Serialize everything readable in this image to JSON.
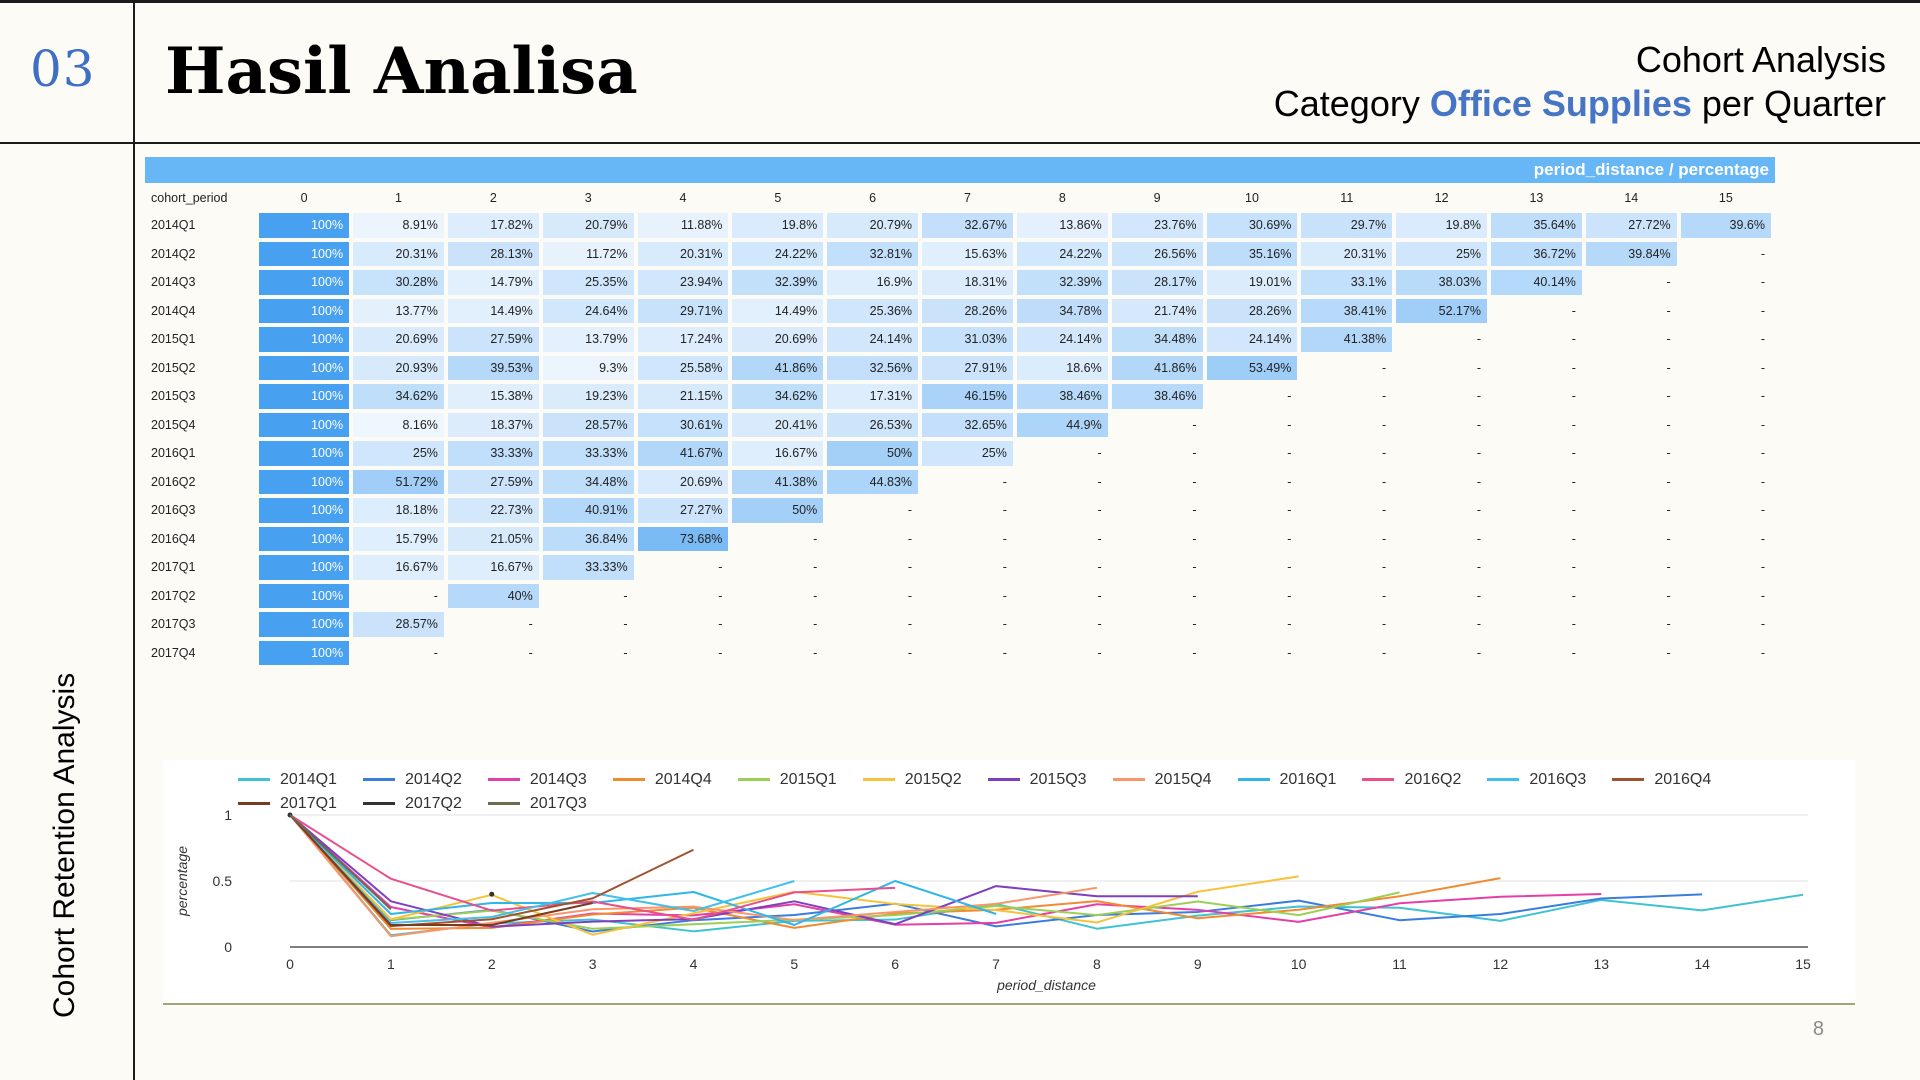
{
  "header": {
    "section_number": "03",
    "title": "Hasil Analisa",
    "subtitle_line1": "Cohort Analysis",
    "subtitle_prefix": "Category ",
    "subtitle_highlight": "Office Supplies",
    "subtitle_suffix": " per Quarter"
  },
  "side_label": "Cohort Retention Analysis",
  "page_number": "8",
  "colors": {
    "accent_blue": "#4675c6",
    "header_bar": "#67b7f7",
    "heat_full": "#47a1f0"
  },
  "table": {
    "header_bar_label": "period_distance / percentage",
    "row_header_label": "cohort_period",
    "columns": [
      "0",
      "1",
      "2",
      "3",
      "4",
      "5",
      "6",
      "7",
      "8",
      "9",
      "10",
      "11",
      "12",
      "13",
      "14",
      "15"
    ],
    "rows": [
      {
        "cohort": "2014Q1",
        "values": [
          "100%",
          "8.91%",
          "17.82%",
          "20.79%",
          "11.88%",
          "19.8%",
          "20.79%",
          "32.67%",
          "13.86%",
          "23.76%",
          "30.69%",
          "29.7%",
          "19.8%",
          "35.64%",
          "27.72%",
          "39.6%"
        ]
      },
      {
        "cohort": "2014Q2",
        "values": [
          "100%",
          "20.31%",
          "28.13%",
          "11.72%",
          "20.31%",
          "24.22%",
          "32.81%",
          "15.63%",
          "24.22%",
          "26.56%",
          "35.16%",
          "20.31%",
          "25%",
          "36.72%",
          "39.84%",
          "-"
        ]
      },
      {
        "cohort": "2014Q3",
        "values": [
          "100%",
          "30.28%",
          "14.79%",
          "25.35%",
          "23.94%",
          "32.39%",
          "16.9%",
          "18.31%",
          "32.39%",
          "28.17%",
          "19.01%",
          "33.1%",
          "38.03%",
          "40.14%",
          "-",
          "-"
        ]
      },
      {
        "cohort": "2014Q4",
        "values": [
          "100%",
          "13.77%",
          "14.49%",
          "24.64%",
          "29.71%",
          "14.49%",
          "25.36%",
          "28.26%",
          "34.78%",
          "21.74%",
          "28.26%",
          "38.41%",
          "52.17%",
          "-",
          "-",
          "-"
        ]
      },
      {
        "cohort": "2015Q1",
        "values": [
          "100%",
          "20.69%",
          "27.59%",
          "13.79%",
          "17.24%",
          "20.69%",
          "24.14%",
          "31.03%",
          "24.14%",
          "34.48%",
          "24.14%",
          "41.38%",
          "-",
          "-",
          "-",
          "-"
        ]
      },
      {
        "cohort": "2015Q2",
        "values": [
          "100%",
          "20.93%",
          "39.53%",
          "9.3%",
          "25.58%",
          "41.86%",
          "32.56%",
          "27.91%",
          "18.6%",
          "41.86%",
          "53.49%",
          "-",
          "-",
          "-",
          "-",
          "-"
        ]
      },
      {
        "cohort": "2015Q3",
        "values": [
          "100%",
          "34.62%",
          "15.38%",
          "19.23%",
          "21.15%",
          "34.62%",
          "17.31%",
          "46.15%",
          "38.46%",
          "38.46%",
          "-",
          "-",
          "-",
          "-",
          "-",
          "-"
        ]
      },
      {
        "cohort": "2015Q4",
        "values": [
          "100%",
          "8.16%",
          "18.37%",
          "28.57%",
          "30.61%",
          "20.41%",
          "26.53%",
          "32.65%",
          "44.9%",
          "-",
          "-",
          "-",
          "-",
          "-",
          "-",
          "-"
        ]
      },
      {
        "cohort": "2016Q1",
        "values": [
          "100%",
          "25%",
          "33.33%",
          "33.33%",
          "41.67%",
          "16.67%",
          "50%",
          "25%",
          "-",
          "-",
          "-",
          "-",
          "-",
          "-",
          "-",
          "-"
        ]
      },
      {
        "cohort": "2016Q2",
        "values": [
          "100%",
          "51.72%",
          "27.59%",
          "34.48%",
          "20.69%",
          "41.38%",
          "44.83%",
          "-",
          "-",
          "-",
          "-",
          "-",
          "-",
          "-",
          "-",
          "-"
        ]
      },
      {
        "cohort": "2016Q3",
        "values": [
          "100%",
          "18.18%",
          "22.73%",
          "40.91%",
          "27.27%",
          "50%",
          "-",
          "-",
          "-",
          "-",
          "-",
          "-",
          "-",
          "-",
          "-",
          "-"
        ]
      },
      {
        "cohort": "2016Q4",
        "values": [
          "100%",
          "15.79%",
          "21.05%",
          "36.84%",
          "73.68%",
          "-",
          "-",
          "-",
          "-",
          "-",
          "-",
          "-",
          "-",
          "-",
          "-",
          "-"
        ]
      },
      {
        "cohort": "2017Q1",
        "values": [
          "100%",
          "16.67%",
          "16.67%",
          "33.33%",
          "-",
          "-",
          "-",
          "-",
          "-",
          "-",
          "-",
          "-",
          "-",
          "-",
          "-",
          "-"
        ]
      },
      {
        "cohort": "2017Q2",
        "values": [
          "100%",
          "-",
          "40%",
          "-",
          "-",
          "-",
          "-",
          "-",
          "-",
          "-",
          "-",
          "-",
          "-",
          "-",
          "-",
          "-"
        ]
      },
      {
        "cohort": "2017Q3",
        "values": [
          "100%",
          "28.57%",
          "-",
          "-",
          "-",
          "-",
          "-",
          "-",
          "-",
          "-",
          "-",
          "-",
          "-",
          "-",
          "-",
          "-"
        ]
      },
      {
        "cohort": "2017Q4",
        "values": [
          "100%",
          "-",
          "-",
          "-",
          "-",
          "-",
          "-",
          "-",
          "-",
          "-",
          "-",
          "-",
          "-",
          "-",
          "-",
          "-"
        ]
      }
    ]
  },
  "chart_data": {
    "type": "line",
    "xlabel": "period_distance",
    "ylabel": "percentage",
    "x": [
      0,
      1,
      2,
      3,
      4,
      5,
      6,
      7,
      8,
      9,
      10,
      11,
      12,
      13,
      14,
      15
    ],
    "ylim": [
      0,
      1
    ],
    "yticks": [
      0,
      0.5,
      1
    ],
    "grid": true,
    "legend_position": "top",
    "series": [
      {
        "name": "2014Q1",
        "color": "#3fc3d2",
        "values": [
          1,
          0.0891,
          0.1782,
          0.2079,
          0.1188,
          0.198,
          0.2079,
          0.3267,
          0.1386,
          0.2376,
          0.3069,
          0.297,
          0.198,
          0.3564,
          0.2772,
          0.396
        ]
      },
      {
        "name": "2014Q2",
        "color": "#3b7ddd",
        "values": [
          1,
          0.2031,
          0.2813,
          0.1172,
          0.2031,
          0.2422,
          0.3281,
          0.1563,
          0.2422,
          0.2656,
          0.3516,
          0.2031,
          0.25,
          0.3672,
          0.3984,
          null
        ]
      },
      {
        "name": "2014Q3",
        "color": "#e43fa8",
        "values": [
          1,
          0.3028,
          0.1479,
          0.2535,
          0.2394,
          0.3239,
          0.169,
          0.1831,
          0.3239,
          0.2817,
          0.1901,
          0.331,
          0.3803,
          0.4014,
          null,
          null
        ]
      },
      {
        "name": "2014Q4",
        "color": "#f28b30",
        "values": [
          1,
          0.1377,
          0.1449,
          0.2464,
          0.2971,
          0.1449,
          0.2536,
          0.2826,
          0.3478,
          0.2174,
          0.2826,
          0.3841,
          0.5217,
          null,
          null,
          null
        ]
      },
      {
        "name": "2015Q1",
        "color": "#9bcf55",
        "values": [
          1,
          0.2069,
          0.2759,
          0.1379,
          0.1724,
          0.2069,
          0.2414,
          0.3103,
          0.2414,
          0.3448,
          0.2414,
          0.4138,
          null,
          null,
          null,
          null
        ]
      },
      {
        "name": "2015Q2",
        "color": "#f6c23a",
        "values": [
          1,
          0.2093,
          0.3953,
          0.093,
          0.2558,
          0.4186,
          0.3256,
          0.2791,
          0.186,
          0.4186,
          0.5349,
          null,
          null,
          null,
          null,
          null
        ]
      },
      {
        "name": "2015Q3",
        "color": "#7f3fbf",
        "values": [
          1,
          0.3462,
          0.1538,
          0.1923,
          0.2115,
          0.3462,
          0.1731,
          0.4615,
          0.3846,
          0.3846,
          null,
          null,
          null,
          null,
          null,
          null
        ]
      },
      {
        "name": "2015Q4",
        "color": "#f7966b",
        "values": [
          1,
          0.0816,
          0.1837,
          0.2857,
          0.3061,
          0.2041,
          0.2653,
          0.3265,
          0.449,
          null,
          null,
          null,
          null,
          null,
          null,
          null
        ]
      },
      {
        "name": "2016Q1",
        "color": "#2fb6e8",
        "values": [
          1,
          0.25,
          0.3333,
          0.3333,
          0.4167,
          0.1667,
          0.5,
          0.25,
          null,
          null,
          null,
          null,
          null,
          null,
          null,
          null
        ]
      },
      {
        "name": "2016Q2",
        "color": "#e8508c",
        "values": [
          1,
          0.5172,
          0.2759,
          0.3448,
          0.2069,
          0.4138,
          0.4483,
          null,
          null,
          null,
          null,
          null,
          null,
          null,
          null,
          null
        ]
      },
      {
        "name": "2016Q3",
        "color": "#42c0ea",
        "values": [
          1,
          0.1818,
          0.2273,
          0.4091,
          0.2727,
          0.5,
          null,
          null,
          null,
          null,
          null,
          null,
          null,
          null,
          null,
          null
        ]
      },
      {
        "name": "2016Q4",
        "color": "#a0522d",
        "values": [
          1,
          0.1579,
          0.2105,
          0.3684,
          0.7368,
          null,
          null,
          null,
          null,
          null,
          null,
          null,
          null,
          null,
          null,
          null
        ]
      },
      {
        "name": "2017Q1",
        "color": "#7a3a1e",
        "values": [
          1,
          0.1667,
          0.1667,
          0.3333,
          null,
          null,
          null,
          null,
          null,
          null,
          null,
          null,
          null,
          null,
          null,
          null
        ]
      },
      {
        "name": "2017Q2",
        "color": "#333333",
        "values": [
          1,
          null,
          0.4,
          null,
          null,
          null,
          null,
          null,
          null,
          null,
          null,
          null,
          null,
          null,
          null,
          null
        ]
      },
      {
        "name": "2017Q3",
        "color": "#6b6b4e",
        "values": [
          1,
          0.2857,
          null,
          null,
          null,
          null,
          null,
          null,
          null,
          null,
          null,
          null,
          null,
          null,
          null,
          null
        ]
      }
    ]
  }
}
